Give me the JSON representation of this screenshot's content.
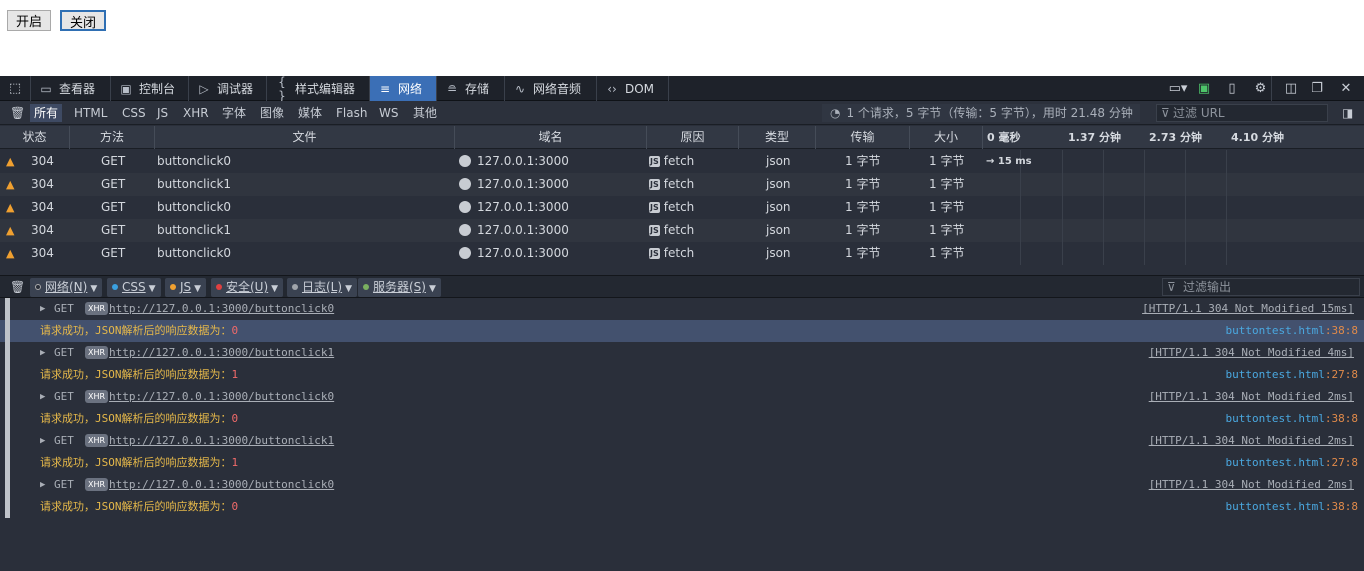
{
  "page": {
    "buttons": [
      {
        "label": "开启"
      },
      {
        "label": "关闭"
      }
    ]
  },
  "devtools": {
    "tabs": [
      {
        "label": "查看器",
        "icon": "inspector-icon"
      },
      {
        "label": "控制台",
        "icon": "console-icon"
      },
      {
        "label": "调试器",
        "icon": "debugger-icon"
      },
      {
        "label": "样式编辑器",
        "icon": "braces-icon"
      },
      {
        "label": "网络",
        "icon": "network-icon"
      },
      {
        "label": "存储",
        "icon": "storage-icon"
      },
      {
        "label": "网络音频",
        "icon": "audio-wave-icon"
      },
      {
        "label": "DOM",
        "icon": "code-icon"
      }
    ],
    "network": {
      "filters": [
        "所有",
        "HTML",
        "CSS",
        "JS",
        "XHR",
        "字体",
        "图像",
        "媒体",
        "Flash",
        "WS",
        "其他"
      ],
      "summary": "1 个请求，5 字节（传输：5 字节），用时 21.48 分钟",
      "filter_placeholder": "过滤 URL",
      "columns": [
        "状态",
        "方法",
        "文件",
        "域名",
        "原因",
        "类型",
        "传输",
        "大小"
      ],
      "timeline": [
        "0 毫秒",
        "1.37 分钟",
        "2.73 分钟",
        "4.10 分钟"
      ],
      "first_timing": "→ 15 ms",
      "requests": [
        {
          "status": "304",
          "method": "GET",
          "file": "buttonclick0",
          "domain": "127.0.0.1:3000",
          "cause": "fetch",
          "type": "json",
          "transfer": "1 字节",
          "size": "1 字节"
        },
        {
          "status": "304",
          "method": "GET",
          "file": "buttonclick1",
          "domain": "127.0.0.1:3000",
          "cause": "fetch",
          "type": "json",
          "transfer": "1 字节",
          "size": "1 字节"
        },
        {
          "status": "304",
          "method": "GET",
          "file": "buttonclick0",
          "domain": "127.0.0.1:3000",
          "cause": "fetch",
          "type": "json",
          "transfer": "1 字节",
          "size": "1 字节"
        },
        {
          "status": "304",
          "method": "GET",
          "file": "buttonclick1",
          "domain": "127.0.0.1:3000",
          "cause": "fetch",
          "type": "json",
          "transfer": "1 字节",
          "size": "1 字节"
        },
        {
          "status": "304",
          "method": "GET",
          "file": "buttonclick0",
          "domain": "127.0.0.1:3000",
          "cause": "fetch",
          "type": "json",
          "transfer": "1 字节",
          "size": "1 字节"
        }
      ]
    },
    "console": {
      "filters": [
        {
          "label": "网络(N)",
          "color": "#2a2f3a"
        },
        {
          "label": "CSS",
          "color": "#3aa0e0"
        },
        {
          "label": "JS",
          "color": "#f0a030"
        },
        {
          "label": "安全(U)",
          "color": "#e04040"
        },
        {
          "label": "日志(L)",
          "color": "#a0a4aa"
        },
        {
          "label": "服务器(S)",
          "color": "#7ab060"
        }
      ],
      "filter_placeholder": "过滤输出",
      "entries": [
        {
          "method": "GET",
          "badge": "XHR",
          "url": "http://127.0.0.1:3000/buttonclick0",
          "status": "[HTTP/1.1 304 Not Modified 15ms]",
          "message": "请求成功，JSON解析后的响应数据为：",
          "value": "0",
          "file": "buttontest.html",
          "line": ":38:8"
        },
        {
          "method": "GET",
          "badge": "XHR",
          "url": "http://127.0.0.1:3000/buttonclick1",
          "status": "[HTTP/1.1 304 Not Modified 4ms]",
          "message": "请求成功，JSON解析后的响应数据为：",
          "value": "1",
          "file": "buttontest.html",
          "line": ":27:8"
        },
        {
          "method": "GET",
          "badge": "XHR",
          "url": "http://127.0.0.1:3000/buttonclick0",
          "status": "[HTTP/1.1 304 Not Modified 2ms]",
          "message": "请求成功，JSON解析后的响应数据为：",
          "value": "0",
          "file": "buttontest.html",
          "line": ":38:8"
        },
        {
          "method": "GET",
          "badge": "XHR",
          "url": "http://127.0.0.1:3000/buttonclick1",
          "status": "[HTTP/1.1 304 Not Modified 2ms]",
          "message": "请求成功，JSON解析后的响应数据为：",
          "value": "1",
          "file": "buttontest.html",
          "line": ":27:8"
        },
        {
          "method": "GET",
          "badge": "XHR",
          "url": "http://127.0.0.1:3000/buttonclick0",
          "status": "[HTTP/1.1 304 Not Modified 2ms]",
          "message": "请求成功，JSON解析后的响应数据为：",
          "value": "0",
          "file": "buttontest.html",
          "line": ":38:8"
        }
      ]
    }
  }
}
